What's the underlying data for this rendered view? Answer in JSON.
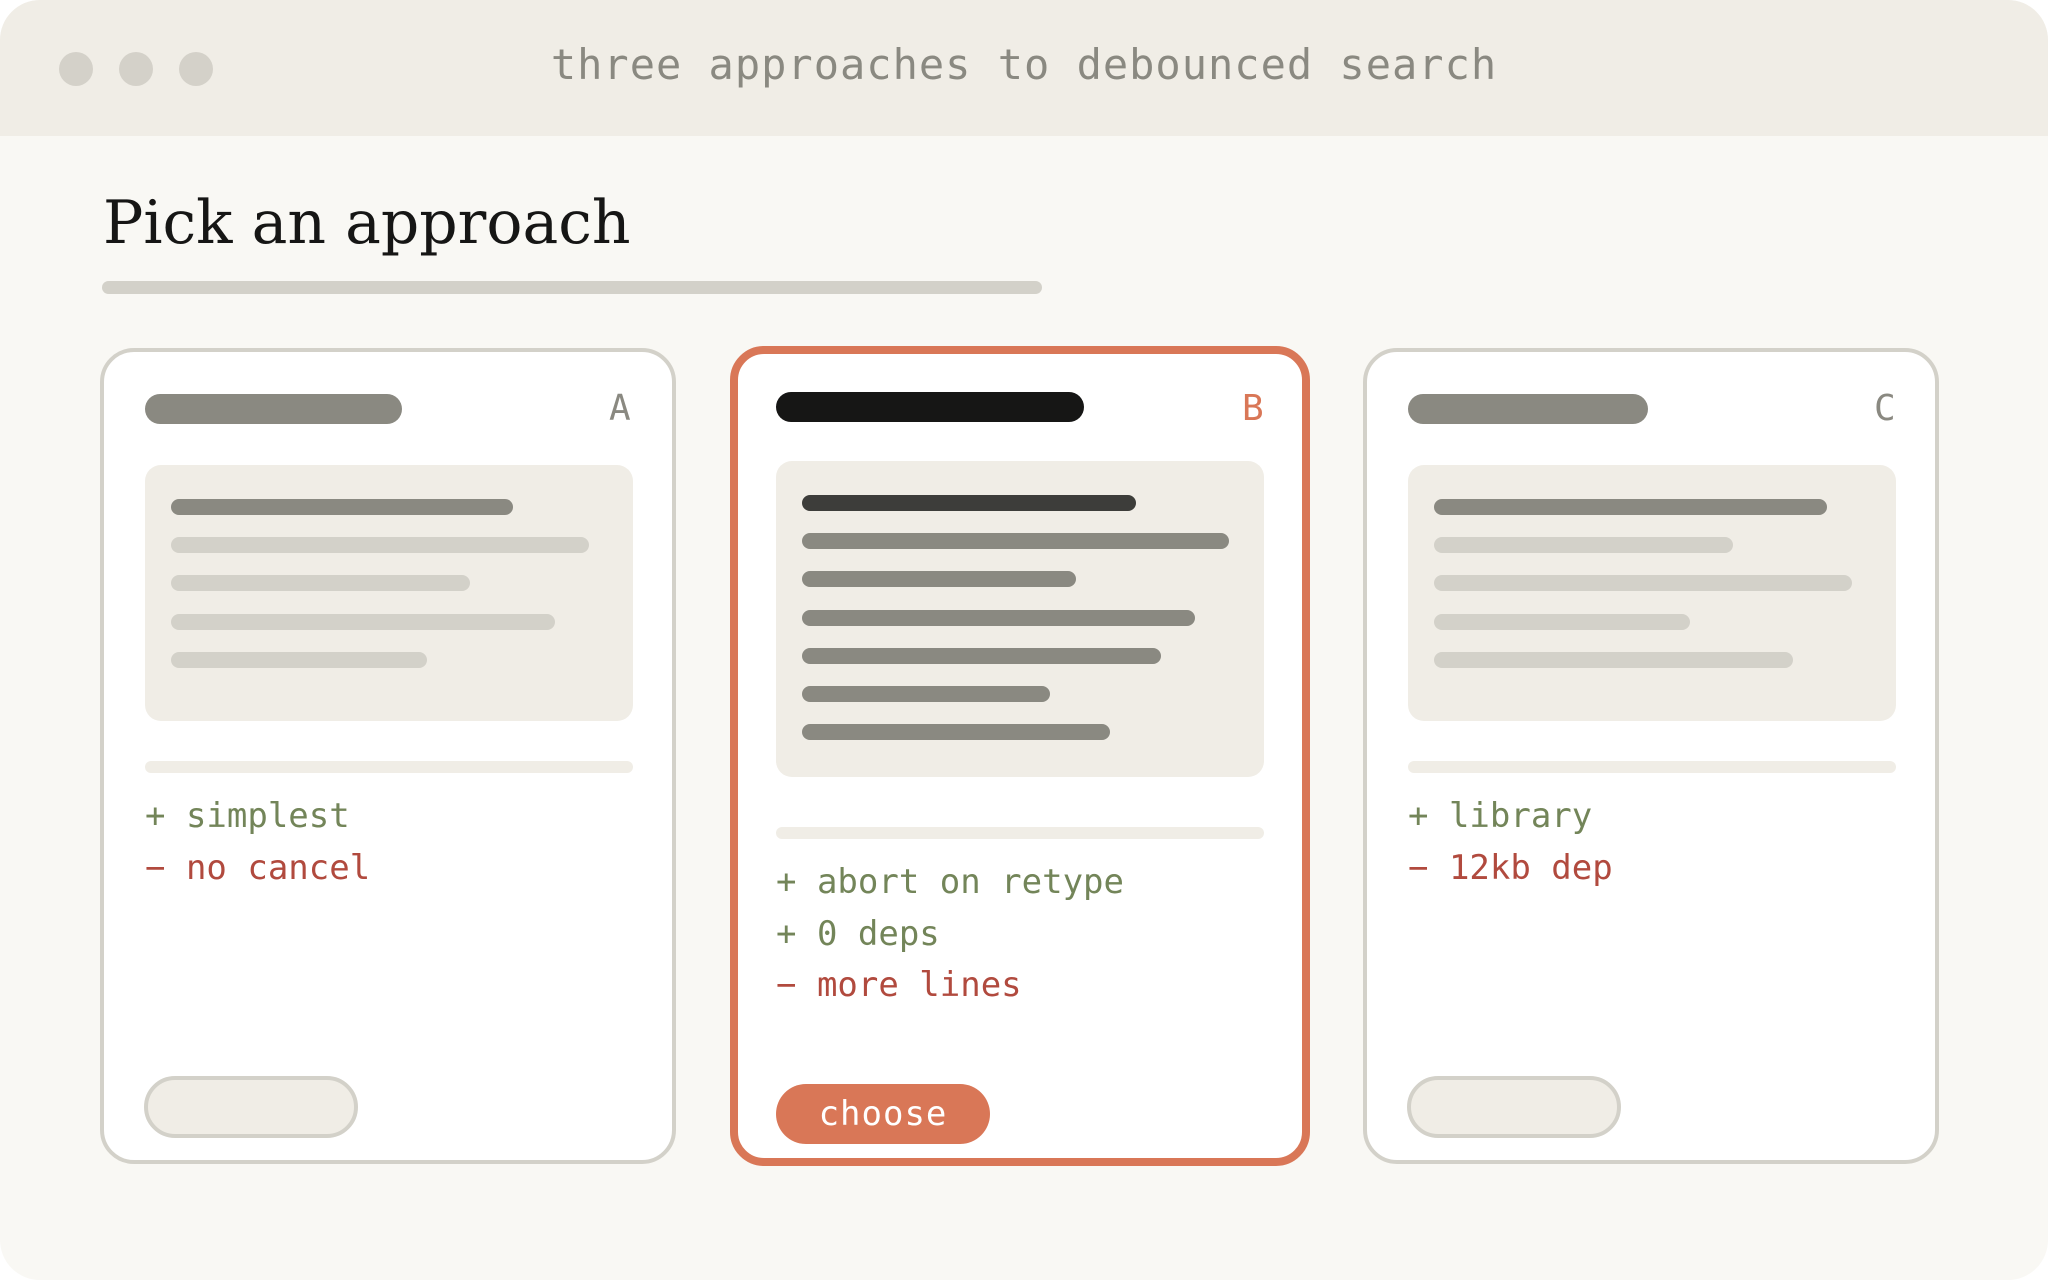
{
  "window": {
    "title": "three approaches to debounced search"
  },
  "page": {
    "heading": "Pick an approach"
  },
  "cards": [
    {
      "letter": "A",
      "selected": false,
      "pros": [
        "+ simplest"
      ],
      "cons": [
        "− no cancel"
      ]
    },
    {
      "letter": "B",
      "selected": true,
      "pros": [
        "+ abort on retype",
        "+ 0 deps"
      ],
      "cons": [
        "− more lines"
      ],
      "button_label": "choose"
    },
    {
      "letter": "C",
      "selected": false,
      "pros": [
        "+ library"
      ],
      "cons": [
        "− 12kb dep"
      ]
    }
  ],
  "colors": {
    "accent": "#d97757",
    "pro": "#738559",
    "con": "#b14a3e"
  }
}
